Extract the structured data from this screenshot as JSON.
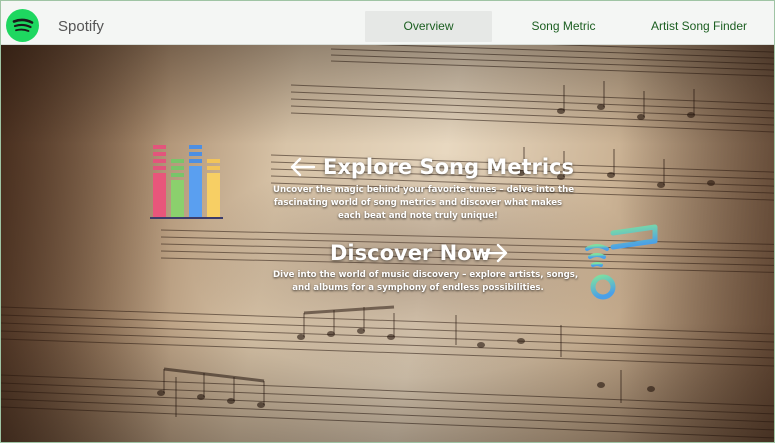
{
  "app": {
    "brand": "Spotify"
  },
  "nav": {
    "tabs": [
      {
        "label": "Overview",
        "active": true
      },
      {
        "label": "Song Metric",
        "active": false
      },
      {
        "label": "Artist Song Finder",
        "active": false
      }
    ]
  },
  "hero": {
    "explore": {
      "title": "Explore Song Metrics",
      "line1": "Uncover the magic behind your favorite tunes – delve into the",
      "line2": "fascinating world of song metrics and discover what makes",
      "line3": "each beat and note truly unique!"
    },
    "discover": {
      "title": "Discover Now",
      "line1": "Dive into the world of music discovery – explore artists, songs,",
      "line2": "and albums for a symphony of endless possibilities."
    }
  },
  "icons": {
    "logo": "spotify-logo-icon",
    "metrics": "equalizer-bars-icon",
    "discover": "music-note-signal-icon",
    "left_arrow": "arrow-left-icon",
    "right_arrow": "arrow-right-icon"
  },
  "colors": {
    "spotify_green": "#1ed760",
    "tab_text": "#1b5e20",
    "note_gradient_start": "#7ee0a0",
    "note_gradient_end": "#4aa0e8"
  }
}
